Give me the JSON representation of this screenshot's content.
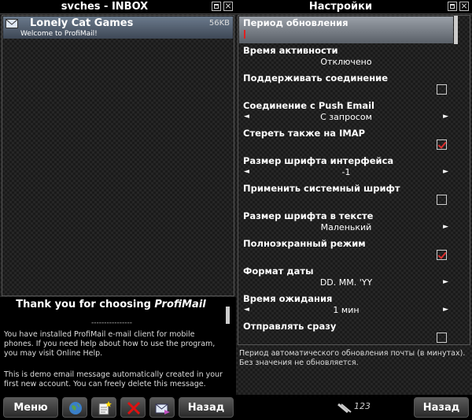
{
  "left_pane": {
    "title": "svches - INBOX",
    "message": {
      "from": "Lonely Cat Games",
      "size": "56KB",
      "subject": "Welcome to ProfiMail!"
    },
    "preview": {
      "heading_prefix": "Thank you for choosing",
      "heading_app": "ProfiMail",
      "separator": "----------------",
      "paragraph1": "You have installed ProfiMail e-mail client for mobile phones. If you need help about how to use the program, you may visit Online Help.",
      "paragraph2": "This is demo email message automatically created in your first new account. You can freely delete this message."
    }
  },
  "right_pane": {
    "title": "Настройки",
    "settings": [
      {
        "label": "Период обновления",
        "type": "text",
        "value": "",
        "selected": true
      },
      {
        "label": "Время активности",
        "type": "text",
        "value": "Отключено"
      },
      {
        "label": "Поддерживать соединение",
        "type": "checkbox",
        "checked": false
      },
      {
        "label": "Соединение с Push Email",
        "type": "select",
        "value": "С запросом"
      },
      {
        "label": "Стереть также на IMAP",
        "type": "checkbox",
        "checked": true
      },
      {
        "label": "Размер шрифта интерфейса",
        "type": "select",
        "value": "-1"
      },
      {
        "label": "Применить системный шрифт",
        "type": "checkbox",
        "checked": false
      },
      {
        "label": "Размер шрифта в тексте",
        "type": "select",
        "value": "Маленький"
      },
      {
        "label": "Полноэкранный режим",
        "type": "checkbox",
        "checked": true
      },
      {
        "label": "Формат даты",
        "type": "select",
        "value": "DD. MM. 'YY"
      },
      {
        "label": "Время ожидания",
        "type": "select",
        "value": "1 мин"
      },
      {
        "label": "Отправлять сразу",
        "type": "checkbox",
        "checked": false
      }
    ],
    "description": "Период автоматического обновления почты (в минутах). Без значения не обновляется."
  },
  "bottom_bar": {
    "menu_label": "Меню",
    "back_left_label": "Назад",
    "status_text": "123",
    "back_right_label": "Назад"
  },
  "icons": {
    "arrow_left": "◄",
    "arrow_right": "►"
  }
}
